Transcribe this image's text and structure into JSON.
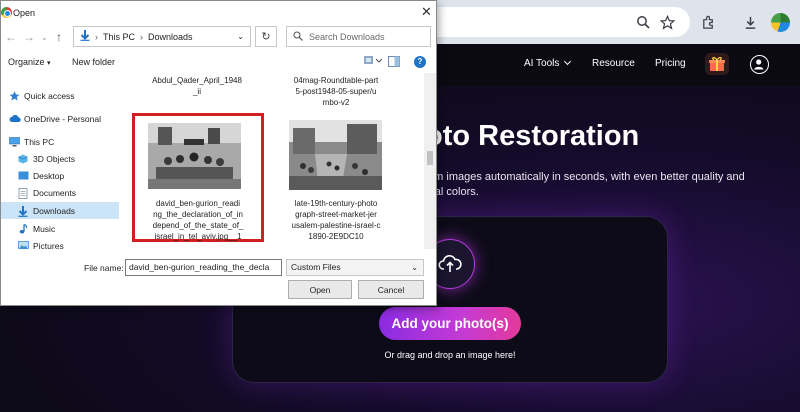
{
  "browser": {
    "icons": [
      "zoom-icon",
      "star-icon",
      "extensions-icon",
      "download-icon",
      "profile-avatar"
    ]
  },
  "site": {
    "nav": {
      "ai_tools": "AI Tools",
      "resource": "Resource",
      "pricing": "Pricing"
    },
    "hero_title": "oto Restoration",
    "hero_subtitle_line1": "tom images automatically in seconds, with even better quality and",
    "hero_subtitle_line2": "ural colors.",
    "add_photo_label": "Add your photo(s)",
    "drag_hint": "Or drag and drop an image here!"
  },
  "dialog": {
    "title": "Open",
    "address": [
      "This PC",
      "Downloads"
    ],
    "search_placeholder": "Search Downloads",
    "organize_label": "Organize",
    "new_folder_label": "New folder",
    "nav_items": [
      {
        "label": "Quick access",
        "icon": "star-icon"
      },
      {
        "label": "OneDrive - Personal",
        "icon": "cloud-icon"
      },
      {
        "label": "This PC",
        "icon": "computer-icon"
      },
      {
        "label": "3D Objects",
        "icon": "cube-icon"
      },
      {
        "label": "Desktop",
        "icon": "desktop-icon"
      },
      {
        "label": "Documents",
        "icon": "documents-icon"
      },
      {
        "label": "Downloads",
        "icon": "download-icon"
      },
      {
        "label": "Music",
        "icon": "music-icon"
      },
      {
        "label": "Pictures",
        "icon": "pictures-icon"
      }
    ],
    "files": [
      {
        "name_lines": [
          "Abdul_Qader_April_1948",
          "_ii"
        ]
      },
      {
        "name_lines": [
          "04mag-Roundtable-part",
          "5-post1948-05-super/u",
          "mbo-v2"
        ]
      },
      {
        "name_lines": [
          "david_ben-gurion_readi",
          "ng_the_declaration_of_in",
          "depend_of_the_state_of_",
          "israel_in_tel_aviv.jpg__1"
        ]
      },
      {
        "name_lines": [
          "late-19th-century-photo",
          "graph-street-market-jer",
          "usalem-palestine-israel-c",
          "1890-2E9DC10"
        ]
      }
    ],
    "file_name_label": "File name:",
    "file_name_value": "david_ben-gurion_reading_the_decla",
    "file_type_value": "Custom Files",
    "open_label": "Open",
    "cancel_label": "Cancel"
  }
}
